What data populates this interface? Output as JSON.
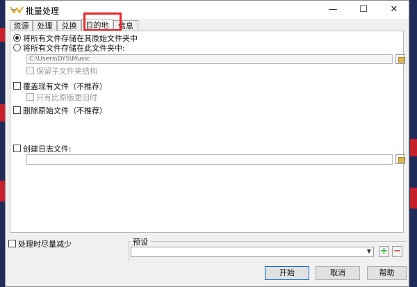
{
  "window": {
    "title": "批量处理",
    "minimize": "—",
    "maximize": "☐",
    "close": "✕"
  },
  "tabs": [
    {
      "label": "资源"
    },
    {
      "label": "处理"
    },
    {
      "label": "兑换"
    },
    {
      "label": "目的地"
    },
    {
      "label": "信息"
    }
  ],
  "destination": {
    "option_original": "将所有文件存储在其原始文件夹中",
    "option_folder": "将所有文件存储在此文件夹中:",
    "folder_path": "C:\\Users\\DYS\\Music",
    "keep_subfolders": "保留子文件夹结构",
    "overwrite": "覆盖现有文件（不推荐）",
    "only_newer": "只有比原版更旧时",
    "delete_original": "删除原始文件（不推荐）",
    "create_log": "创建日志文件:"
  },
  "footer": {
    "minimize_while_processing": "处理时尽量减少",
    "preset_label": "预设",
    "add_symbol": "+",
    "remove_symbol": "−",
    "start": "开始",
    "cancel": "取消",
    "help": "帮助"
  },
  "colors": {
    "highlight": "#e8232a",
    "plus": "#3aa832",
    "minus": "#d34545"
  },
  "icons": [
    "app-logo-icon",
    "folder-browse-icon",
    "chevron-down-icon",
    "plus-icon",
    "minus-icon"
  ]
}
